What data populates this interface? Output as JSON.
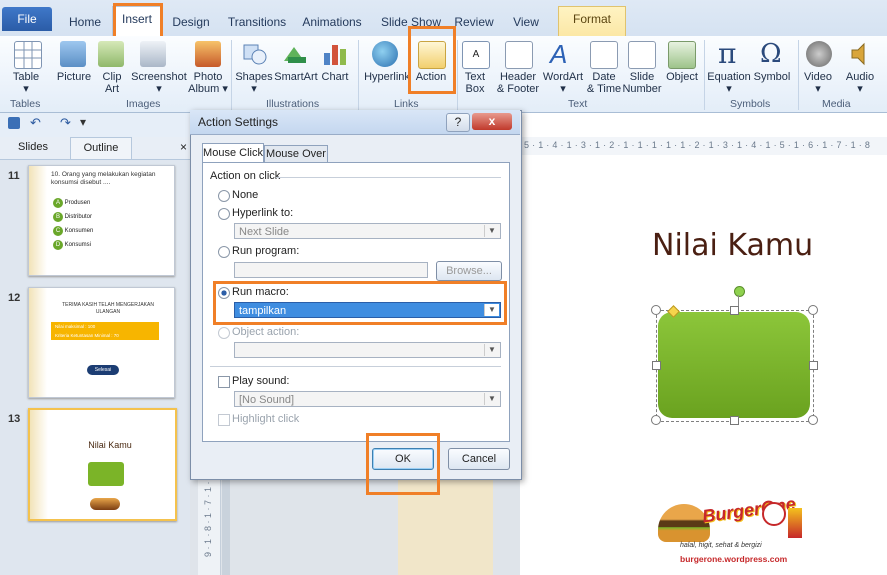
{
  "tabs": [
    "File",
    "Home",
    "Insert",
    "Design",
    "Transitions",
    "Animations",
    "Slide Show",
    "Review",
    "View",
    "Format"
  ],
  "ribbon": {
    "items": [
      {
        "l1": "Table",
        "l2": ""
      },
      {
        "l1": "Picture",
        "l2": ""
      },
      {
        "l1": "Clip",
        "l2": "Art"
      },
      {
        "l1": "Screenshot",
        "l2": ""
      },
      {
        "l1": "Photo",
        "l2": "Album"
      },
      {
        "l1": "Shapes",
        "l2": ""
      },
      {
        "l1": "SmartArt",
        "l2": ""
      },
      {
        "l1": "Chart",
        "l2": ""
      },
      {
        "l1": "Hyperlink",
        "l2": ""
      },
      {
        "l1": "Action",
        "l2": ""
      },
      {
        "l1": "Text",
        "l2": "Box"
      },
      {
        "l1": "Header",
        "l2": "& Footer"
      },
      {
        "l1": "WordArt",
        "l2": ""
      },
      {
        "l1": "Date",
        "l2": "& Time"
      },
      {
        "l1": "Slide",
        "l2": "Number"
      },
      {
        "l1": "Object",
        "l2": ""
      },
      {
        "l1": "Equation",
        "l2": ""
      },
      {
        "l1": "Symbol",
        "l2": ""
      },
      {
        "l1": "Video",
        "l2": ""
      },
      {
        "l1": "Audio",
        "l2": ""
      }
    ],
    "groups": [
      "Tables",
      "Images",
      "Illustrations",
      "Links",
      "Text",
      "Symbols",
      "Media"
    ]
  },
  "panel": {
    "tab_slides": "Slides",
    "tab_outline": "Outline",
    "close": "×"
  },
  "slides": {
    "s11": {
      "num": "11",
      "question": "10. Orang yang melakukan kegiatan konsumsi disebut ....",
      "options": [
        {
          "k": "A",
          "t": "Produsen"
        },
        {
          "k": "B",
          "t": "Distributor"
        },
        {
          "k": "C",
          "t": "Konsumen"
        },
        {
          "k": "D",
          "t": "Konsumsi"
        }
      ]
    },
    "s12": {
      "num": "12",
      "title": "TERIMA KASIH TELAH MENGERJAKAN ULANGAN",
      "row1": "Nilai maksimal          : 100",
      "row2": "Kriteria Ketuntasan Minimal : 70",
      "button": "Selesai"
    },
    "s13": {
      "num": "13",
      "title": "Nilai Kamu"
    }
  },
  "slide_main": {
    "title": "Nilai Kamu",
    "logo_text": "burgerone.wordpress.com",
    "logo_word": "BurgerOne",
    "logo_tagline": "halal, higit, sehat & bergizi"
  },
  "ruler": "5 · 1 · 4 · 1 · 3 · 1 · 2 · 1 · 1 · 1 · 1 · 1 · 2 · 1 · 3 · 1 · 4 · 1 · 5 · 1 · 6 · 1 · 7 · 1 · 8",
  "vruler": "9 · 1 · 8 · 1 · 7 · 1 · 6",
  "dialog": {
    "title": "Action Settings",
    "help": "?",
    "close": "x",
    "tab_click": "Mouse Click",
    "tab_over": "Mouse Over",
    "section": "Action on click",
    "opt_none": "None",
    "opt_hyperlink": "Hyperlink to:",
    "hyperlink_value": "Next Slide",
    "opt_program": "Run program:",
    "browse": "Browse...",
    "opt_macro": "Run macro:",
    "macro_value": "tampilkan",
    "opt_object": "Object action:",
    "play_sound": "Play sound:",
    "sound_value": "[No Sound]",
    "highlight": "Highlight click",
    "ok": "OK",
    "cancel": "Cancel"
  },
  "colors": {
    "accent": "#f07f27",
    "shape_green": "#7bb428",
    "file_tab": "#2b5ca7"
  }
}
